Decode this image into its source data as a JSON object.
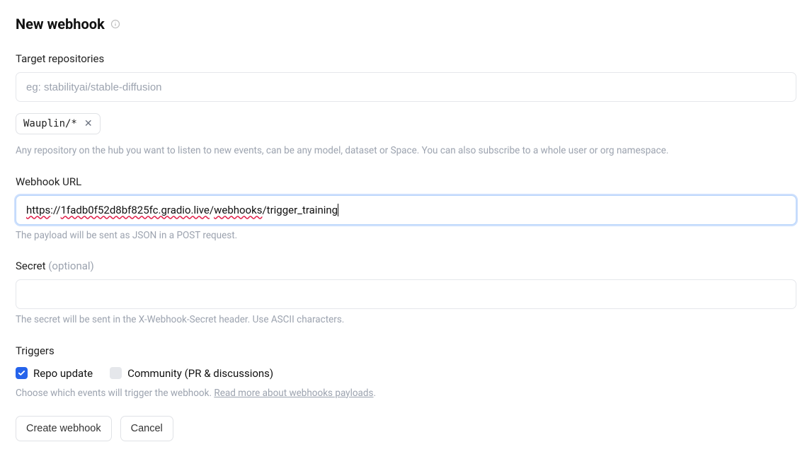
{
  "heading": {
    "title": "New webhook"
  },
  "targetRepos": {
    "label": "Target repositories",
    "placeholder": "eg: stabilityai/stable-diffusion",
    "chips": [
      {
        "text": "Wauplin/*"
      }
    ],
    "help": "Any repository on the hub you want to listen to new events, can be any model, dataset or Space. You can also subscribe to a whole user or org namespace."
  },
  "webhookUrl": {
    "label": "Webhook URL",
    "segments": {
      "s1": "https",
      "p1": "://",
      "s2": "1fadb0f52d8bf825fc.gradio.live",
      "p2": "/",
      "s3": "webhooks",
      "p3": "/trigger_training"
    },
    "help": "The payload will be sent as JSON in a POST request."
  },
  "secret": {
    "label": "Secret ",
    "optional": "(optional)",
    "value": "",
    "help": "The secret will be sent in the X-Webhook-Secret header. Use ASCII characters."
  },
  "triggers": {
    "label": "Triggers",
    "options": {
      "repoUpdate": {
        "label": "Repo update",
        "checked": true
      },
      "community": {
        "label": "Community (PR & discussions)",
        "checked": false
      }
    },
    "helpPrefix": "Choose which events will trigger the webhook. ",
    "helpLink": "Read more about webhooks payloads",
    "helpSuffix": "."
  },
  "buttons": {
    "create": "Create webhook",
    "cancel": "Cancel"
  }
}
